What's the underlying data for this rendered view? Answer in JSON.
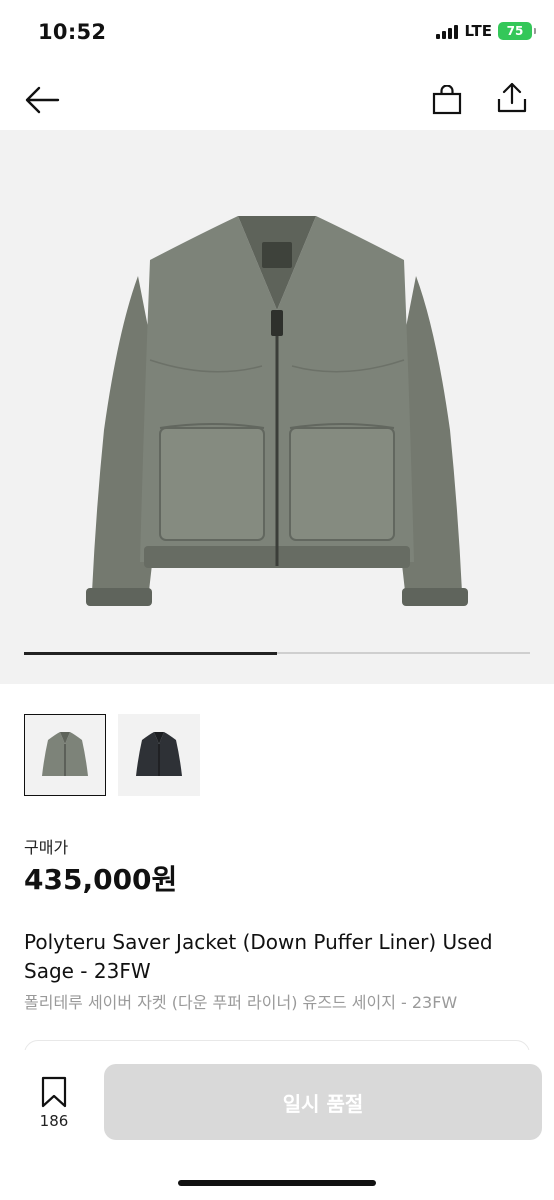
{
  "status_bar": {
    "time": "10:52",
    "network": "LTE",
    "battery": "75"
  },
  "nav": {
    "back_icon": "arrow-left-icon",
    "bag_icon": "shopping-bag-icon",
    "share_icon": "share-icon"
  },
  "gallery": {
    "image_count": 2,
    "current_index": 1,
    "progress_fraction": 0.5,
    "thumbnails": [
      {
        "colorway": "sage",
        "selected": true
      },
      {
        "colorway": "black",
        "selected": false
      }
    ]
  },
  "product": {
    "price_label": "구매가",
    "price": "435,000원",
    "title_en": "Polyteru Saver Jacket (Down Puffer Liner) Used Sage - 23FW",
    "title_ko": "폴리테루 세이버 자켓 (다운 푸퍼 라이너) 유즈드 세이지 - 23FW"
  },
  "bottom_bar": {
    "wish_icon": "bookmark-icon",
    "wish_count": "186",
    "action_label": "일시 품절"
  },
  "colors": {
    "sold_out_button": "#d9d9d9",
    "image_background": "#f2f2f2",
    "battery_green": "#34c759",
    "jacket_sage": "#7d8379",
    "jacket_black": "#2e3136"
  }
}
